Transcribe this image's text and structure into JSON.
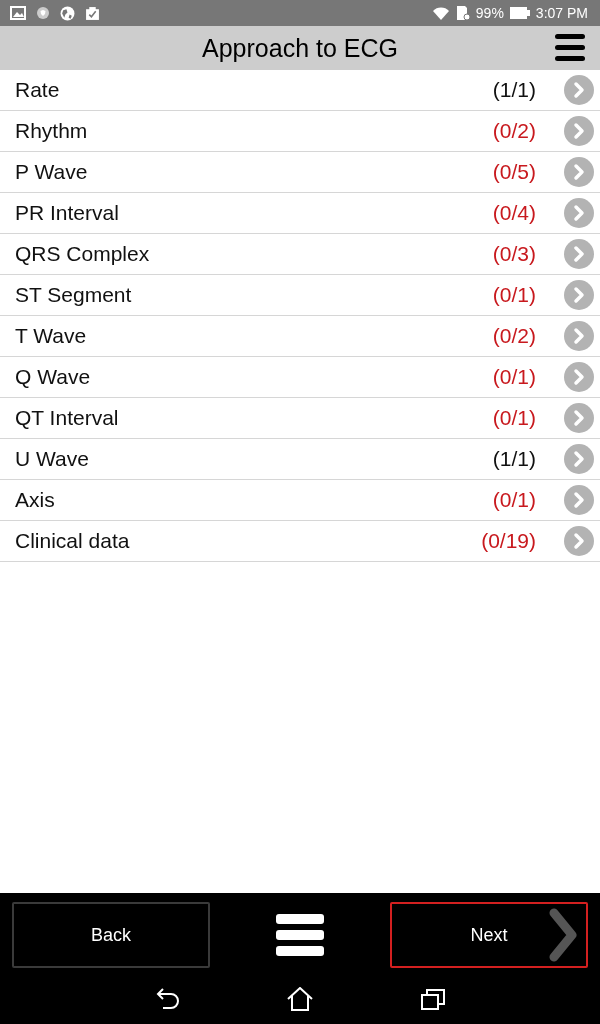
{
  "status_bar": {
    "battery": "99%",
    "time": "3:07 PM"
  },
  "header": {
    "title": "Approach to ECG"
  },
  "items": [
    {
      "label": "Rate",
      "score": "(1/1)",
      "complete": true
    },
    {
      "label": "Rhythm",
      "score": "(0/2)",
      "complete": false
    },
    {
      "label": "P Wave",
      "score": "(0/5)",
      "complete": false
    },
    {
      "label": "PR Interval",
      "score": "(0/4)",
      "complete": false
    },
    {
      "label": "QRS Complex",
      "score": "(0/3)",
      "complete": false
    },
    {
      "label": "ST Segment",
      "score": "(0/1)",
      "complete": false
    },
    {
      "label": "T Wave",
      "score": "(0/2)",
      "complete": false
    },
    {
      "label": "Q Wave",
      "score": "(0/1)",
      "complete": false
    },
    {
      "label": "QT Interval",
      "score": "(0/1)",
      "complete": false
    },
    {
      "label": "U Wave",
      "score": "(1/1)",
      "complete": true
    },
    {
      "label": "Axis",
      "score": "(0/1)",
      "complete": false
    },
    {
      "label": "Clinical data",
      "score": "(0/19)",
      "complete": false
    }
  ],
  "footer": {
    "back": {
      "label": "Back",
      "highlighted": false
    },
    "next": {
      "label": "Next",
      "highlighted": true
    }
  }
}
